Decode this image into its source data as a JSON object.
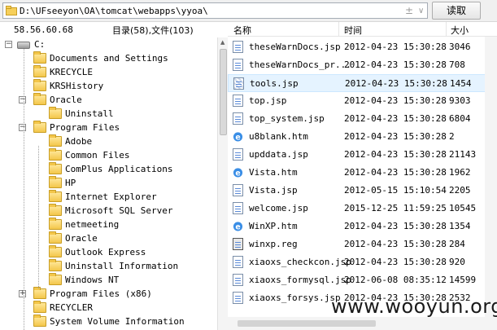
{
  "toolbar": {
    "path": "D:\\UFseeyon\\OA\\tomcat\\webapps\\yyoa\\",
    "read_label": "读取",
    "combo_plus": "±",
    "combo_arrow": "∨"
  },
  "info": {
    "ip": "58.56.60.68",
    "dir_count": "目录(58),文件(103)"
  },
  "tree": {
    "nodes": [
      {
        "label": "C:",
        "type": "drive"
      },
      {
        "label": "Documents and Settings",
        "type": "folder"
      },
      {
        "label": "KRECYCLE",
        "type": "folder"
      },
      {
        "label": "KRSHistory",
        "type": "folder"
      },
      {
        "label": "Oracle",
        "type": "folder"
      },
      {
        "label": "Uninstall",
        "type": "folder"
      },
      {
        "label": "Program Files",
        "type": "folder"
      },
      {
        "label": "Adobe",
        "type": "folder"
      },
      {
        "label": "Common Files",
        "type": "folder"
      },
      {
        "label": "ComPlus Applications",
        "type": "folder"
      },
      {
        "label": "HP",
        "type": "folder"
      },
      {
        "label": "Internet Explorer",
        "type": "folder"
      },
      {
        "label": "Microsoft SQL Server",
        "type": "folder"
      },
      {
        "label": "netmeeting",
        "type": "folder"
      },
      {
        "label": "Oracle",
        "type": "folder"
      },
      {
        "label": "Outlook Express",
        "type": "folder"
      },
      {
        "label": "Uninstall Information",
        "type": "folder"
      },
      {
        "label": "Windows NT",
        "type": "folder"
      },
      {
        "label": "Program Files (x86)",
        "type": "folder"
      },
      {
        "label": "RECYCLER",
        "type": "folder"
      },
      {
        "label": "System Volume Information",
        "type": "folder"
      }
    ]
  },
  "list": {
    "headers": {
      "name": "名称",
      "time": "时间",
      "size": "大小"
    },
    "rows": [
      {
        "name": "theseWarnDocs.jsp",
        "time": "2012-04-23 15:30:28",
        "size": "3046",
        "icon": "jsp-file-icon"
      },
      {
        "name": "theseWarnDocs_pr...",
        "time": "2012-04-23 15:30:28",
        "size": "708",
        "icon": "jsp-file-icon"
      },
      {
        "name": "tools.jsp",
        "time": "2012-04-23 15:30:28",
        "size": "1454",
        "icon": "jsp-file-icon"
      },
      {
        "name": "top.jsp",
        "time": "2012-04-23 15:30:28",
        "size": "9303",
        "icon": "jsp-file-icon"
      },
      {
        "name": "top_system.jsp",
        "time": "2012-04-23 15:30:28",
        "size": "6804",
        "icon": "jsp-file-icon"
      },
      {
        "name": "u8blank.htm",
        "time": "2012-04-23 15:30:28",
        "size": "2",
        "icon": "ie-file-icon"
      },
      {
        "name": "upddata.jsp",
        "time": "2012-04-23 15:30:28",
        "size": "21143",
        "icon": "jsp-file-icon"
      },
      {
        "name": "Vista.htm",
        "time": "2012-04-23 15:30:28",
        "size": "1962",
        "icon": "ie-file-icon"
      },
      {
        "name": "Vista.jsp",
        "time": "2012-05-15 15:10:54",
        "size": "2205",
        "icon": "jsp-file-icon"
      },
      {
        "name": "welcome.jsp",
        "time": "2015-12-25 11:59:25",
        "size": "10545",
        "icon": "jsp-file-icon"
      },
      {
        "name": "WinXP.htm",
        "time": "2012-04-23 15:30:28",
        "size": "1354",
        "icon": "ie-file-icon"
      },
      {
        "name": "winxp.reg",
        "time": "2012-04-23 15:30:28",
        "size": "284",
        "icon": "reg-file-icon"
      },
      {
        "name": "xiaoxs_checkcon.jsp",
        "time": "2012-04-23 15:30:28",
        "size": "920",
        "icon": "jsp-file-icon"
      },
      {
        "name": "xiaoxs_formysql.jsp",
        "time": "2012-06-08 08:35:12",
        "size": "14599",
        "icon": "jsp-file-icon"
      },
      {
        "name": "xiaoxs_forsys.jsp",
        "time": "2012-04-23 15:30:28",
        "size": "2532",
        "icon": "jsp-file-icon"
      }
    ],
    "selected_index": 2
  },
  "watermark": "www.wooyun.org"
}
